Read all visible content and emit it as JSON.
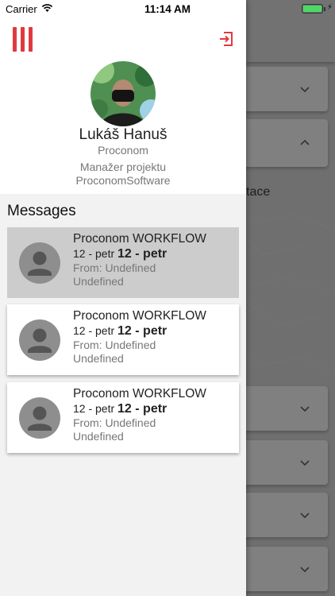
{
  "status_bar": {
    "carrier": "Carrier",
    "time": "11:14 AM"
  },
  "background": {
    "partial_text": "tace"
  },
  "drawer": {
    "user": {
      "name": "Lukáš Hanuš",
      "company": "Proconom",
      "role": "Manažer projektu",
      "organization": "ProconomSoftware"
    },
    "messages_title": "Messages",
    "messages": [
      {
        "title": "Proconom WORKFLOW",
        "subject_small": "12 - petr",
        "subject_bold": "12 - petr",
        "from": "From: Undefined",
        "extra": "Undefined",
        "selected": true
      },
      {
        "title": "Proconom WORKFLOW",
        "subject_small": "12 - petr",
        "subject_bold": "12 - petr",
        "from": "From: Undefined",
        "extra": "Undefined",
        "selected": false
      },
      {
        "title": "Proconom WORKFLOW",
        "subject_small": "12 - petr",
        "subject_bold": "12 - petr",
        "from": "From: Undefined",
        "extra": "Undefined",
        "selected": false
      }
    ]
  },
  "colors": {
    "accent": "#e03a3f",
    "battery": "#4cd964",
    "selected_row": "#cccccc"
  }
}
